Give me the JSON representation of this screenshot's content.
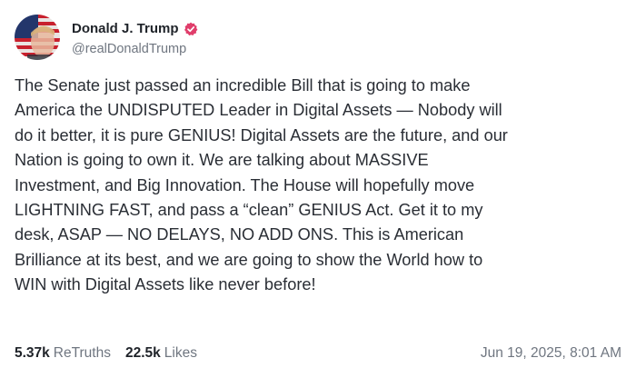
{
  "author": {
    "display_name": "Donald J. Trump",
    "handle": "@realDonaldTrump",
    "avatar_icon": "user-avatar-flag",
    "verified_icon": "verified-badge-icon",
    "verified_color": "#e03e6b"
  },
  "post": {
    "lines": [
      "The Senate just passed an incredible Bill that is going to make",
      "America the UNDISPUTED Leader in Digital Assets — Nobody will",
      "do it better, it is pure GENIUS! Digital Assets are the future, and our",
      "Nation is going to own it. We are talking about MASSIVE",
      "Investment, and Big Innovation. The House will hopefully move",
      "LIGHTNING FAST, and pass a “clean” GENIUS Act. Get it to my",
      "desk, ASAP — NO DELAYS, NO ADD ONS. This is American",
      "Brilliance at its best, and we are going to show the World how to",
      "WIN with Digital Assets like never before!"
    ]
  },
  "stats": {
    "retruths_count": "5.37k",
    "retruths_label": "ReTruths",
    "likes_count": "22.5k",
    "likes_label": "Likes"
  },
  "timestamp": "Jun 19, 2025, 8:01 AM"
}
